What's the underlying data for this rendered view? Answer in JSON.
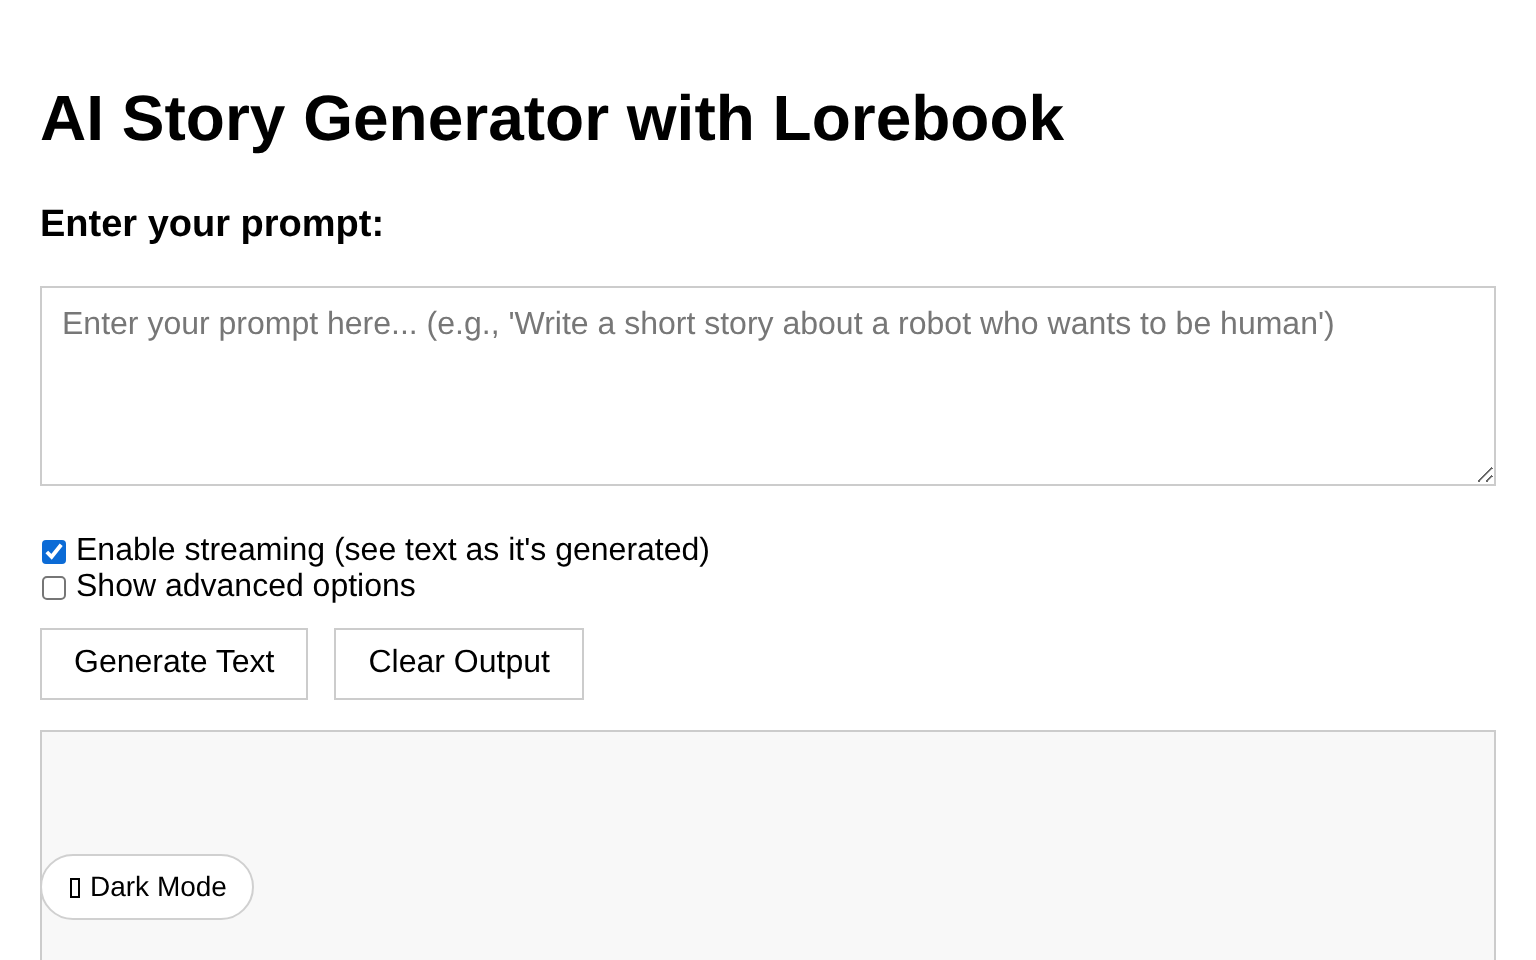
{
  "title": "AI Story Generator with Lorebook",
  "prompt": {
    "label": "Enter your prompt:",
    "placeholder": "Enter your prompt here... (e.g., 'Write a short story about a robot who wants to be human')"
  },
  "options": [
    {
      "label": "Enable streaming (see text as it's generated)",
      "checked": true
    },
    {
      "label": "Show advanced options",
      "checked": false
    }
  ],
  "buttons": [
    "Generate Text",
    "Clear Output"
  ],
  "theme_toggle": {
    "label": "Dark Mode"
  }
}
